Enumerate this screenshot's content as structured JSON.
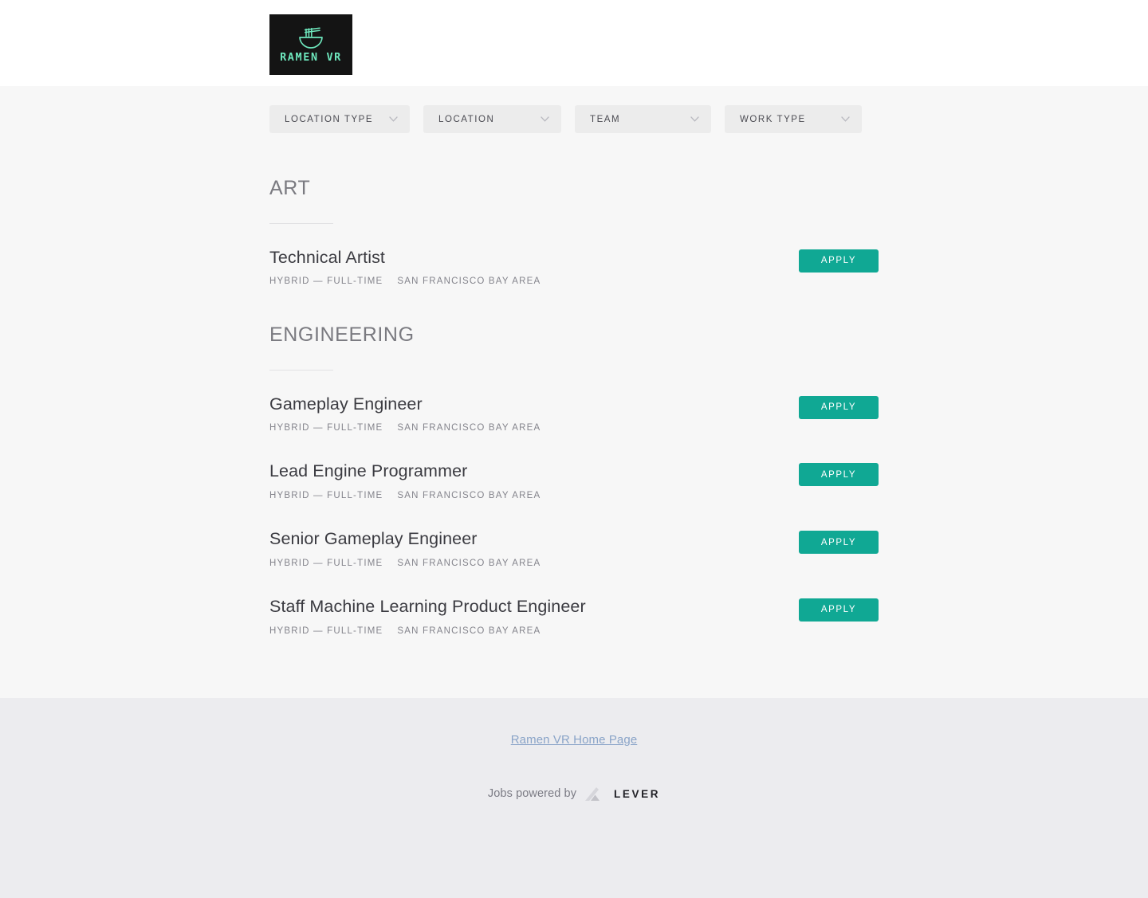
{
  "header": {
    "logo": {
      "name": "ramen-vr-logo",
      "wordmark": "RAMEN VR",
      "icon": "ramen-bowl-icon",
      "background_color": "#141414",
      "accent_color": "#6ee7bd"
    }
  },
  "filters": [
    {
      "id": "location-type",
      "label": "LOCATION TYPE",
      "icon": "chevron-down-icon"
    },
    {
      "id": "location",
      "label": "LOCATION",
      "icon": "chevron-down-icon"
    },
    {
      "id": "team",
      "label": "TEAM",
      "icon": "chevron-down-icon"
    },
    {
      "id": "work-type",
      "label": "WORK TYPE",
      "icon": "chevron-down-icon"
    }
  ],
  "sections": [
    {
      "id": "art",
      "title": "ART",
      "jobs": [
        {
          "title": "Technical Artist",
          "commitment": "HYBRID — FULL-TIME",
          "location": "SAN FRANCISCO BAY AREA",
          "apply_label": "APPLY"
        }
      ]
    },
    {
      "id": "engineering",
      "title": "ENGINEERING",
      "jobs": [
        {
          "title": "Gameplay Engineer",
          "commitment": "HYBRID — FULL-TIME",
          "location": "SAN FRANCISCO BAY AREA",
          "apply_label": "APPLY"
        },
        {
          "title": "Lead Engine Programmer",
          "commitment": "HYBRID — FULL-TIME",
          "location": "SAN FRANCISCO BAY AREA",
          "apply_label": "APPLY"
        },
        {
          "title": "Senior Gameplay Engineer",
          "commitment": "HYBRID — FULL-TIME",
          "location": "SAN FRANCISCO BAY AREA",
          "apply_label": "APPLY"
        },
        {
          "title": "Staff Machine Learning Product Engineer",
          "commitment": "HYBRID — FULL-TIME",
          "location": "SAN FRANCISCO BAY AREA",
          "apply_label": "APPLY"
        }
      ]
    }
  ],
  "footer": {
    "home_link": "Ramen VR Home Page",
    "powered_text": "Jobs powered by",
    "powered_brand": "LEVER",
    "powered_icon": "lever-logo-icon"
  },
  "colors": {
    "apply_button": "#10a894",
    "page_background": "#f7f7f7",
    "footer_background": "#ececef",
    "filter_background": "#ececec",
    "link": "#8aa4c8"
  }
}
